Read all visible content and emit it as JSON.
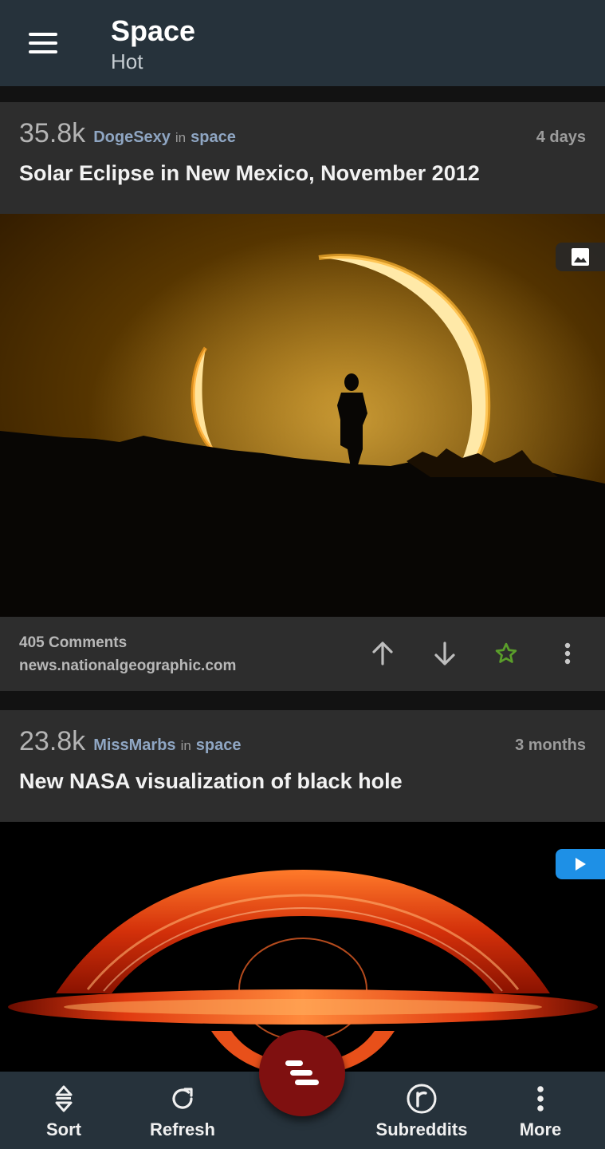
{
  "app": {
    "title": "Space",
    "subtitle": "Hot"
  },
  "colors": {
    "topbar": "#26323b",
    "card": "#2d2d2d",
    "link": "#8fa6c3",
    "fab": "#7f1010",
    "starred": "#5a9e2a",
    "play_badge": "#1e90e6"
  },
  "posts": [
    {
      "score": "35.8k",
      "author": "DogeSexy",
      "in_word": "in",
      "subreddit": "space",
      "age": "4 days",
      "title": "Solar Eclipse in New Mexico, November 2012",
      "media_type": "image",
      "media_badge_icon": "image-icon",
      "comments": "405 Comments",
      "domain": "news.nationalgeographic.com",
      "starred": true
    },
    {
      "score": "23.8k",
      "author": "MissMarbs",
      "in_word": "in",
      "subreddit": "space",
      "age": "3 months",
      "title": "New NASA visualization of black hole",
      "media_type": "video",
      "media_badge_icon": "play-icon"
    }
  ],
  "bottom_nav": {
    "items": [
      {
        "label": "Sort",
        "icon": "sort-icon"
      },
      {
        "label": "Refresh",
        "icon": "refresh-icon"
      },
      {
        "label": "Subreddits",
        "icon": "reddit-icon"
      },
      {
        "label": "More",
        "icon": "more-vertical-icon"
      }
    ],
    "fab_icon": "menu-lines-icon"
  }
}
